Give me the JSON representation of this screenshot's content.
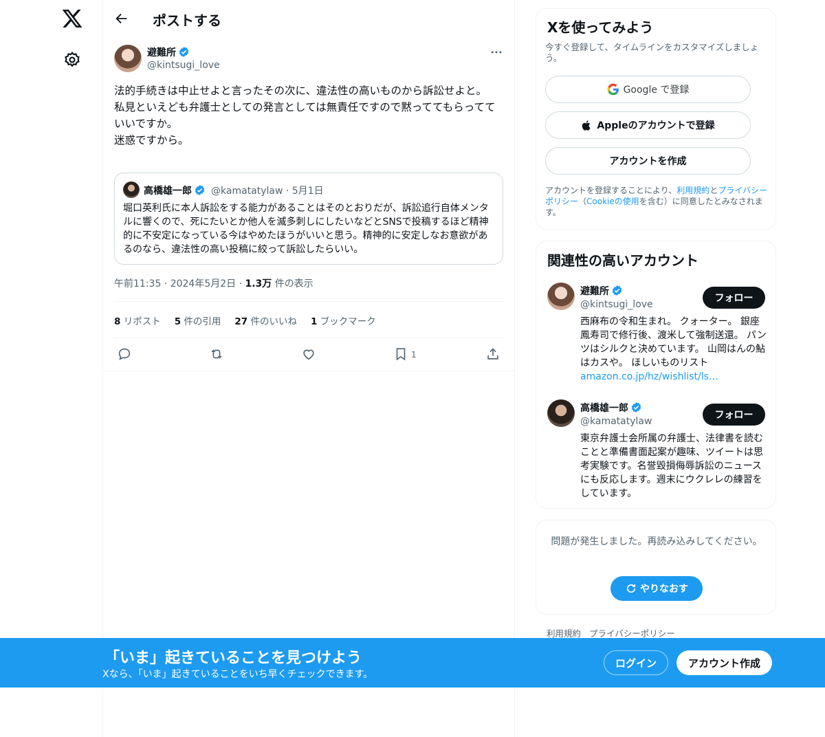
{
  "nav": {
    "logo_icon": "x-logo-icon",
    "settings_icon": "gear-icon"
  },
  "header": {
    "title": "ポストする",
    "back_icon": "arrow-left-icon"
  },
  "post": {
    "author_name": "避難所",
    "author_handle": "@kintsugi_love",
    "text": "法的手続きは中止せよと言ったその次に、違法性の高いものから訴訟せよと。\n私見といえども弁護士としての発言としては無責任ですので黙っててもらってていいですか。\n迷惑ですから。",
    "quote": {
      "author_name": "高橋雄一郎",
      "author_handle": "@kamatatylaw",
      "date": "· 5月1日",
      "text": "堀口英利氏に本人訴訟をする能力があることはそのとおりだが、訴訟追行自体メンタルに響くので、死にたいとか他人を滅多刺しにしたいなどとSNSで投稿するほど精神的に不安定になっている今はやめたほうがいいと思う。精神的に安定しなお意欲があるのなら、違法性の高い投稿に絞って訴訟したらいい。"
    },
    "time_date": "午前11:35 · 2024年5月2日 · ",
    "views_count": "1.3万",
    "views_label": " 件の表示",
    "stats": {
      "reposts_count": "8",
      "reposts_label": " リポスト",
      "quotes_count": "5",
      "quotes_label": " 件の引用",
      "likes_count": "27",
      "likes_label": " 件のいいね",
      "bookmarks_count": "1",
      "bookmarks_label": " ブックマーク"
    },
    "bookmark_action_count": "1"
  },
  "signup": {
    "title": "Xを使ってみよう",
    "subtitle": "今すぐ登録して、タイムラインをカスタマイズしましょう。",
    "google_label": "Google で登録",
    "apple_label": "Appleのアカウントで登録",
    "create_label": "アカウントを作成",
    "legal_prefix": "アカウントを登録することにより、",
    "terms_link": "利用規約",
    "legal_and": "と",
    "privacy_link": "プライバシーポリシー",
    "legal_paren_open": "（",
    "cookie_link": "Cookieの使用",
    "legal_suffix": "を含む）に同意したとみなされます。"
  },
  "related": {
    "title": "関連性の高いアカウント",
    "accounts": [
      {
        "name": "避難所",
        "handle": "@kintsugi_love",
        "bio": "西麻布の令和生まれ。 クォーター。 銀座鳳寿司で修行後、渡米して強制送還。 パンツはシルクと決めています。 山岡はんの鮎はカスや。 ほしいものリスト",
        "bio_link": "amazon.co.jp/hz/wishlist/ls…",
        "follow_label": "フォロー"
      },
      {
        "name": "高橋雄一郎",
        "handle": "@kamatatylaw",
        "bio": "東京弁護士会所属の弁護士、法律書を読むことと準備書面起案が趣味、ツイートは思考実験です。名誉毀損侮辱訴訟のニュースにも反応します。週末にウクレレの練習をしています。",
        "follow_label": "フォロー"
      }
    ]
  },
  "error": {
    "message": "問題が発生しました。再読み込みしてください。",
    "retry_label": "やりなおす"
  },
  "footer": {
    "terms": "利用規約",
    "privacy": "プライバシーポリシー"
  },
  "banner": {
    "title": "「いま」起きていることを見つけよう",
    "subtitle": "Xなら、「いま」起きていることをいち早くチェックできます。",
    "login_label": "ログイン",
    "signup_label": "アカウント作成"
  },
  "colors": {
    "accent": "#1d9bf0",
    "text": "#0f1419",
    "secondary": "#536471",
    "border": "#eff3f4"
  }
}
